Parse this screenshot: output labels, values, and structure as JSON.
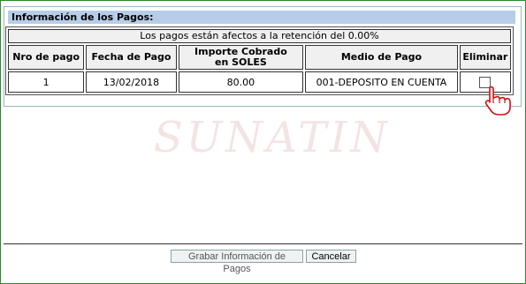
{
  "section": {
    "title": "Información de los Pagos:"
  },
  "table": {
    "notice": "Los pagos están afectos a la retención del 0.00%",
    "headers": [
      "Nro de pago",
      "Fecha de Pago",
      "Importe Cobrado en SOLES",
      "Medio de Pago",
      "Eliminar"
    ],
    "rows": [
      {
        "nro": "1",
        "fecha": "13/02/2018",
        "importe": "80.00",
        "medio": "001-DEPOSITO EN CUENTA",
        "eliminar_checked": false
      }
    ]
  },
  "watermark": "SUNATIN",
  "buttons": {
    "save_label": "Grabar Información de Pagos",
    "cancel_label": "Cancelar"
  },
  "colors": {
    "frame_border": "#2a8a2a",
    "header_bg": "#b8cde8"
  }
}
